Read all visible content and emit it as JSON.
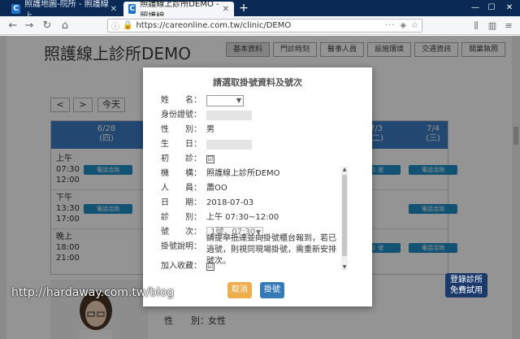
{
  "browser": {
    "tabs": [
      {
        "favicon": "C",
        "label": "照護地圖-院所 - 照護線上"
      },
      {
        "favicon": "C",
        "label": "照護線上診所DEMO - 照護線"
      }
    ],
    "url": "https://careonline.com.tw/clinic/DEMO",
    "url_domain": "careonline.com.tw",
    "window_controls": [
      "—",
      "☐",
      "✕"
    ]
  },
  "page": {
    "title": "照護線上診所DEMO",
    "nav": [
      "基本資料",
      "門診時刻",
      "醫事人員",
      "設施環境",
      "交通資訊",
      "開業執照"
    ],
    "controls": {
      "prev": "<",
      "next": ">",
      "today": "今天"
    },
    "calendar": {
      "headers": [
        {
          "date": "6/28",
          "weekday": "(四)"
        },
        {
          "date": "7/3",
          "weekday": "(二)"
        },
        {
          "date": "7/4",
          "weekday": "(三)"
        }
      ],
      "slots": [
        {
          "period": "上午",
          "start": "07:30",
          "end": "12:00"
        },
        {
          "period": "下午",
          "start": "13:30",
          "end": "17:00"
        },
        {
          "period": "晚上",
          "start": "18:00",
          "end": "21:00"
        }
      ],
      "slot_button": "電話洽詢",
      "partial_button": "01 號"
    },
    "profile": {
      "gender_label": "性　　別：",
      "gender_value": "女性"
    },
    "trial_badge": [
      "登錄診所",
      "免費試用"
    ],
    "watermark": "http://hardaway.com.tw/blog"
  },
  "modal": {
    "title": "請選取掛號資料及號次",
    "fields": {
      "name_label": "姓　　名：",
      "id_label": "身份證號：",
      "gender_label": "性　　別：",
      "gender_value": "男",
      "birth_label": "生　　日：",
      "first_visit_label": "初　　診：",
      "institution_label": "機　　構：",
      "institution_value": "照護線上診所DEMO",
      "staff_label": "人　　員：",
      "staff_value": "蕭OO",
      "date_label": "日　　期：",
      "date_value": "2018-07-03",
      "session_label": "診　　別：",
      "session_value": "上午 07:30~12:00",
      "number_label": "號　　次：",
      "number_value": "1號，07:30",
      "note_label": "掛號說明：",
      "note_value": "請提早抵達並向掛號櫃台報到，若已過號，則視同現場掛號，需重新安排號次。",
      "favorite_label": "加入收藏："
    },
    "checkbox_first_visit": "☑",
    "checkbox_favorite": "☑",
    "cancel_label": "取消",
    "submit_label": "掛號"
  }
}
